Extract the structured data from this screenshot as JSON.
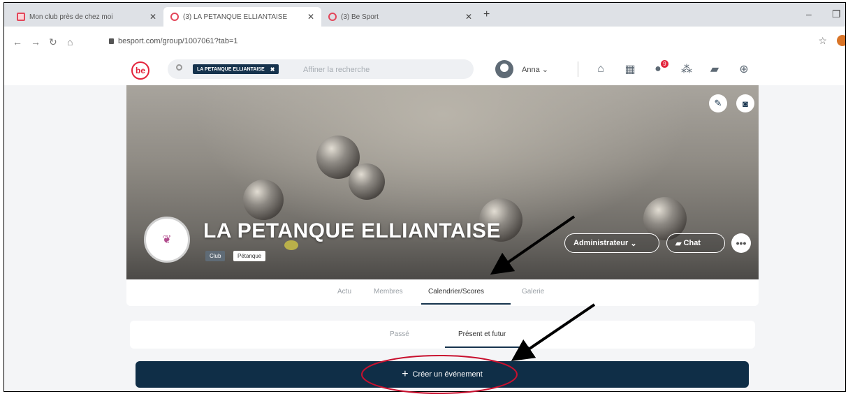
{
  "browser": {
    "tabs": [
      {
        "title": "Mon club près de chez moi",
        "active": false
      },
      {
        "title": "(3) LA PETANQUE ELLIANTAISE",
        "active": true
      },
      {
        "title": "(3) Be Sport",
        "active": false
      }
    ],
    "url": "besport.com/group/1007061?tab=1"
  },
  "header": {
    "logo_text": "be",
    "search_chip": "LA PETANQUE ELLIANTAISE",
    "search_placeholder": "Affiner la recherche",
    "username": "Anna",
    "notification_count": "9"
  },
  "group": {
    "name": "LA PETANQUE ELLIANTAISE",
    "badge_type": "Club",
    "badge_sport": "Pétanque",
    "admin_label": "Administrateur",
    "chat_label": "Chat"
  },
  "group_tabs": [
    "Actu",
    "Membres",
    "Calendrier/Scores",
    "Galerie"
  ],
  "sub_tabs": [
    "Passé",
    "Présent et futur"
  ],
  "create_event_label": "Créer un événement",
  "colors": {
    "brand_red": "#e3233b",
    "navy": "#0f2e47",
    "annotation_red": "#c8102e"
  }
}
